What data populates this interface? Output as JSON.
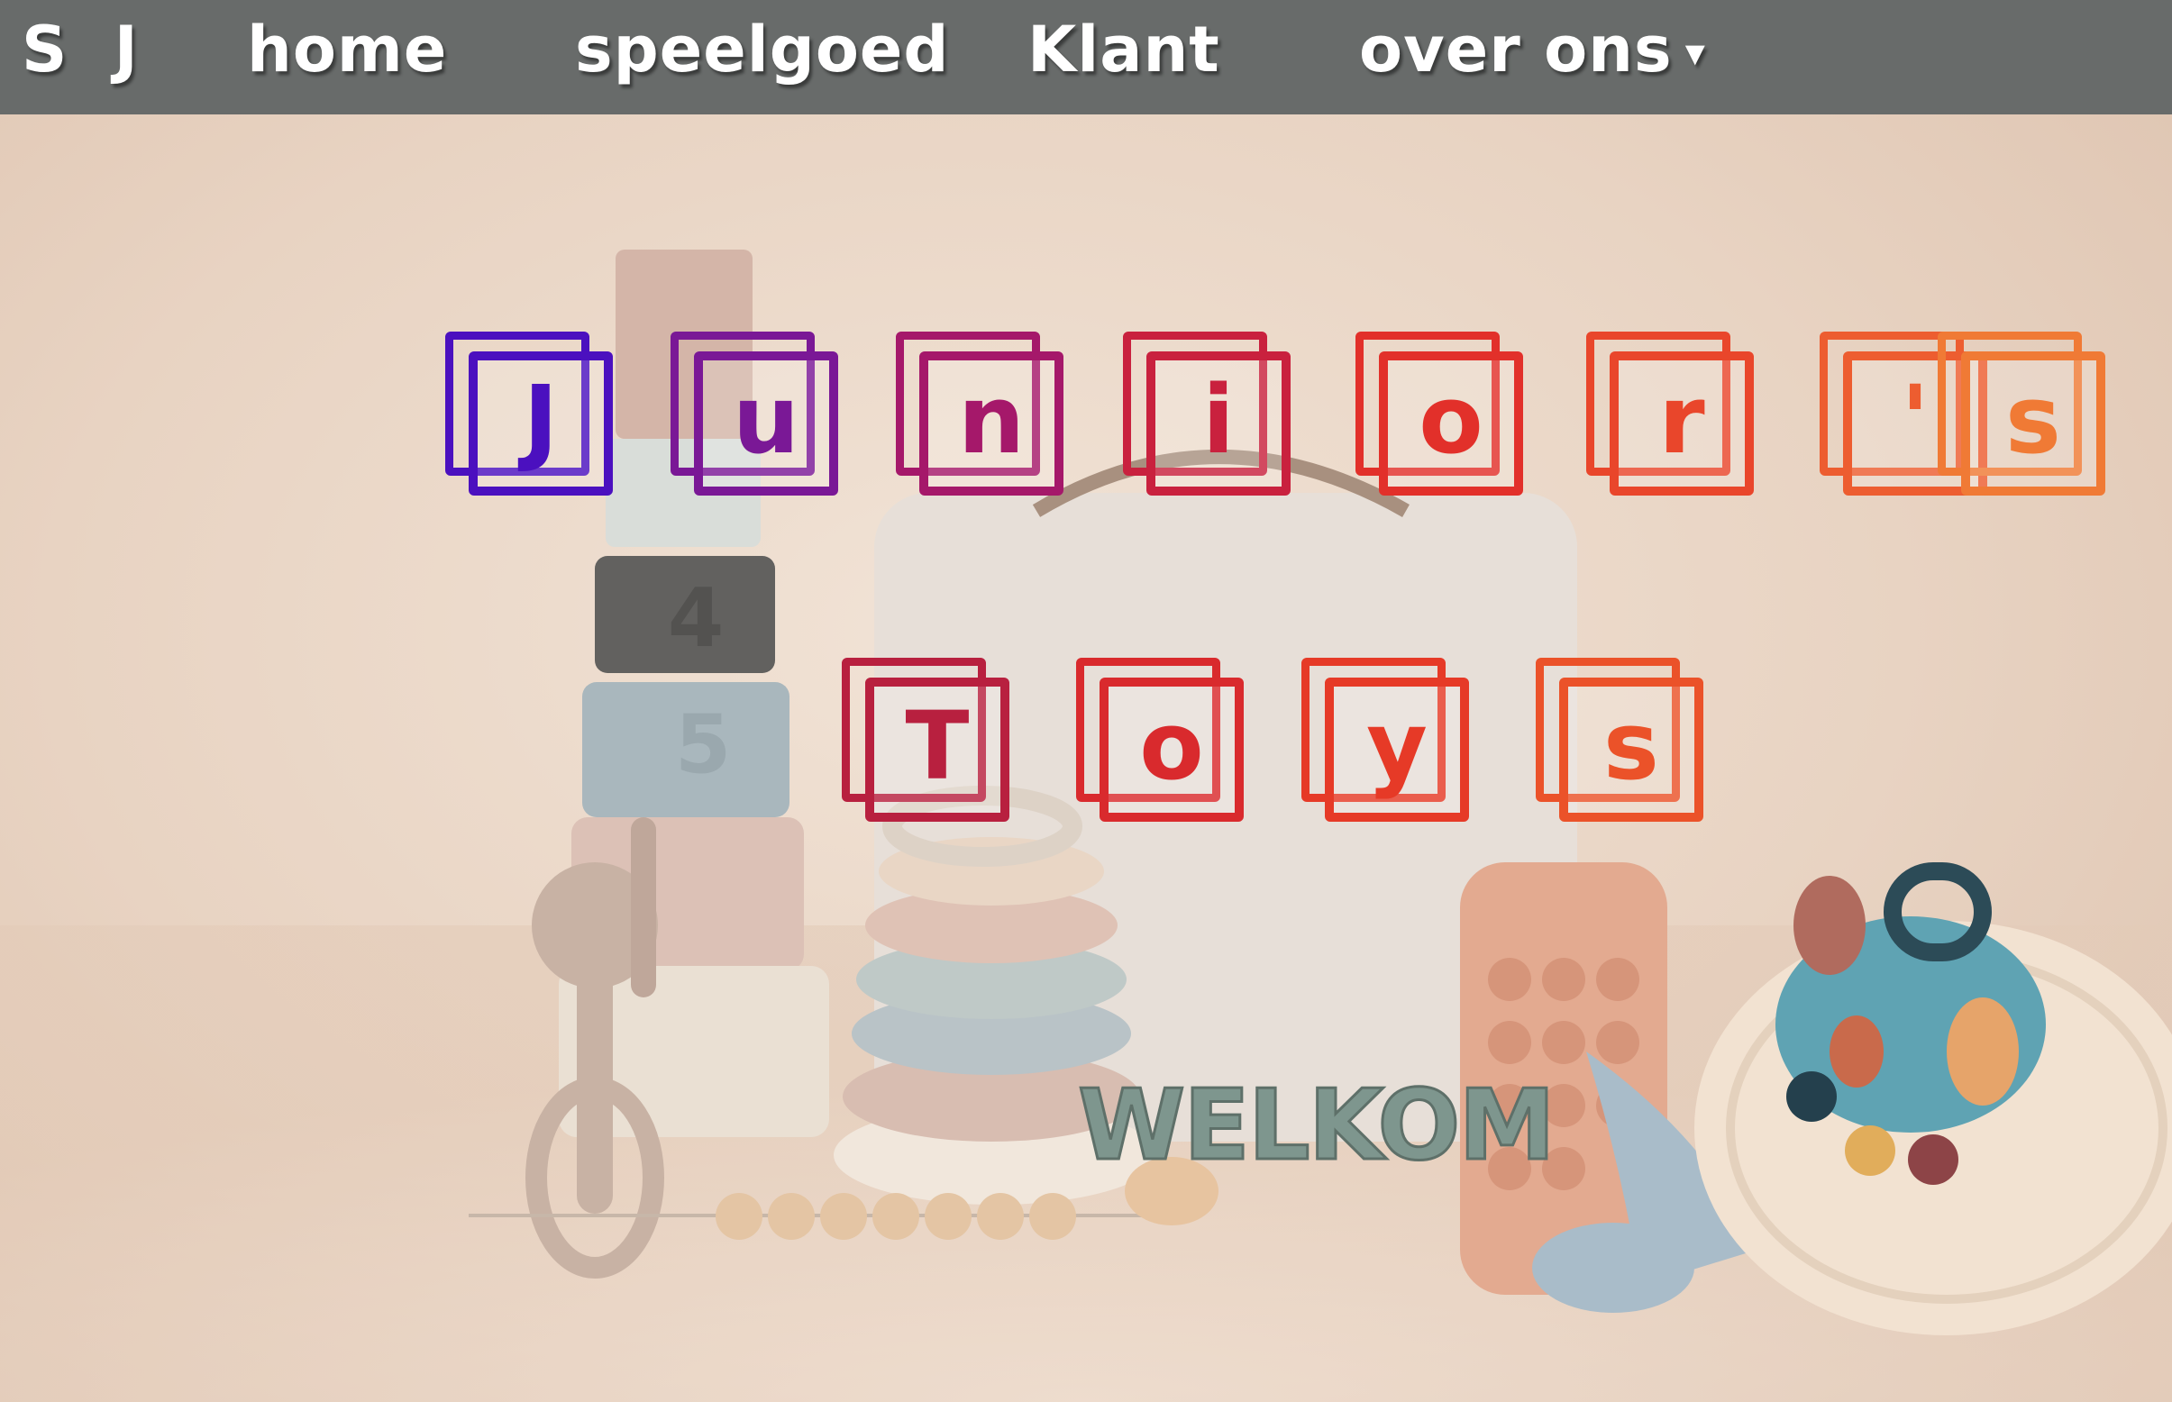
{
  "nav": {
    "logo": "S J",
    "items": [
      {
        "label": "home"
      },
      {
        "label": "speelgoed"
      },
      {
        "label": "Klant"
      },
      {
        "label": "over ons",
        "caret": "▾"
      }
    ]
  },
  "hero": {
    "title_line1": [
      "J",
      "u",
      "n",
      "i",
      "o",
      "r",
      "'",
      "s"
    ],
    "title_line2": [
      "T",
      "o",
      "y",
      "s"
    ],
    "subtitle": "WELKOM",
    "image_description": "baby toys product photo"
  }
}
